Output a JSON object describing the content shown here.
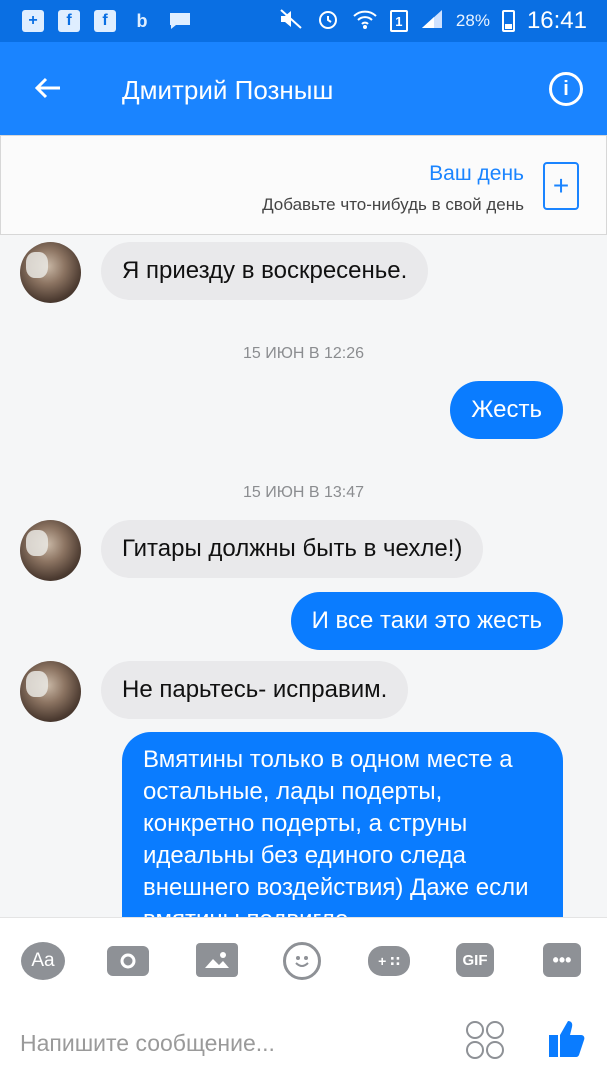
{
  "status_bar": {
    "battery_percent": "28%",
    "time": "16:41",
    "sim_label": "1",
    "icons": [
      "plus-icon",
      "facebook-icon",
      "facebook-icon",
      "b-icon",
      "chat-icon",
      "mute-icon",
      "alarm-icon",
      "wifi-icon",
      "sim-icon",
      "signal-icon",
      "battery-icon"
    ]
  },
  "header": {
    "title": "Дмитрий Позныш",
    "back_icon": "arrow-left-icon",
    "info_icon": "info-icon"
  },
  "your_day": {
    "title": "Ваш день",
    "subtitle": "Добавьте что-нибудь в свой день"
  },
  "messages": [
    {
      "type": "incoming",
      "text": "Я приезду в воскресенье."
    },
    {
      "type": "timestamp",
      "text": "15 ИЮН В 12:26"
    },
    {
      "type": "outgoing",
      "text": "Жесть"
    },
    {
      "type": "timestamp",
      "text": "15 ИЮН В 13:47"
    },
    {
      "type": "incoming",
      "text": "Гитары должны быть в чехле!)"
    },
    {
      "type": "outgoing",
      "text": "И все таки это жесть"
    },
    {
      "type": "incoming",
      "text": "Не парьтесь- исправим."
    },
    {
      "type": "outgoing",
      "text": "Вмятины только в одном месте а остальные, лады подерты, конкретно подерты, а струны идеальны без единого следа внешнего воздействия) Даже если вмятины подвигло..."
    }
  ],
  "toolbar": {
    "aa_label": "Aa",
    "gif_label": "GIF",
    "more_label": "•••",
    "icons": [
      "aa-icon",
      "camera-icon",
      "image-icon",
      "emoji-icon",
      "game-icon",
      "gif-icon",
      "more-icon"
    ]
  },
  "composer": {
    "placeholder": "Напишите сообщение...",
    "sticker_icon": "sticker-icon",
    "like_icon": "thumbs-up-icon"
  },
  "colors": {
    "status_bar": "#0a6fe3",
    "header": "#1a84ff",
    "outgoing_bubble": "#0a7cff",
    "incoming_bubble": "#e9e9eb",
    "chat_background": "#f5f6f7"
  }
}
